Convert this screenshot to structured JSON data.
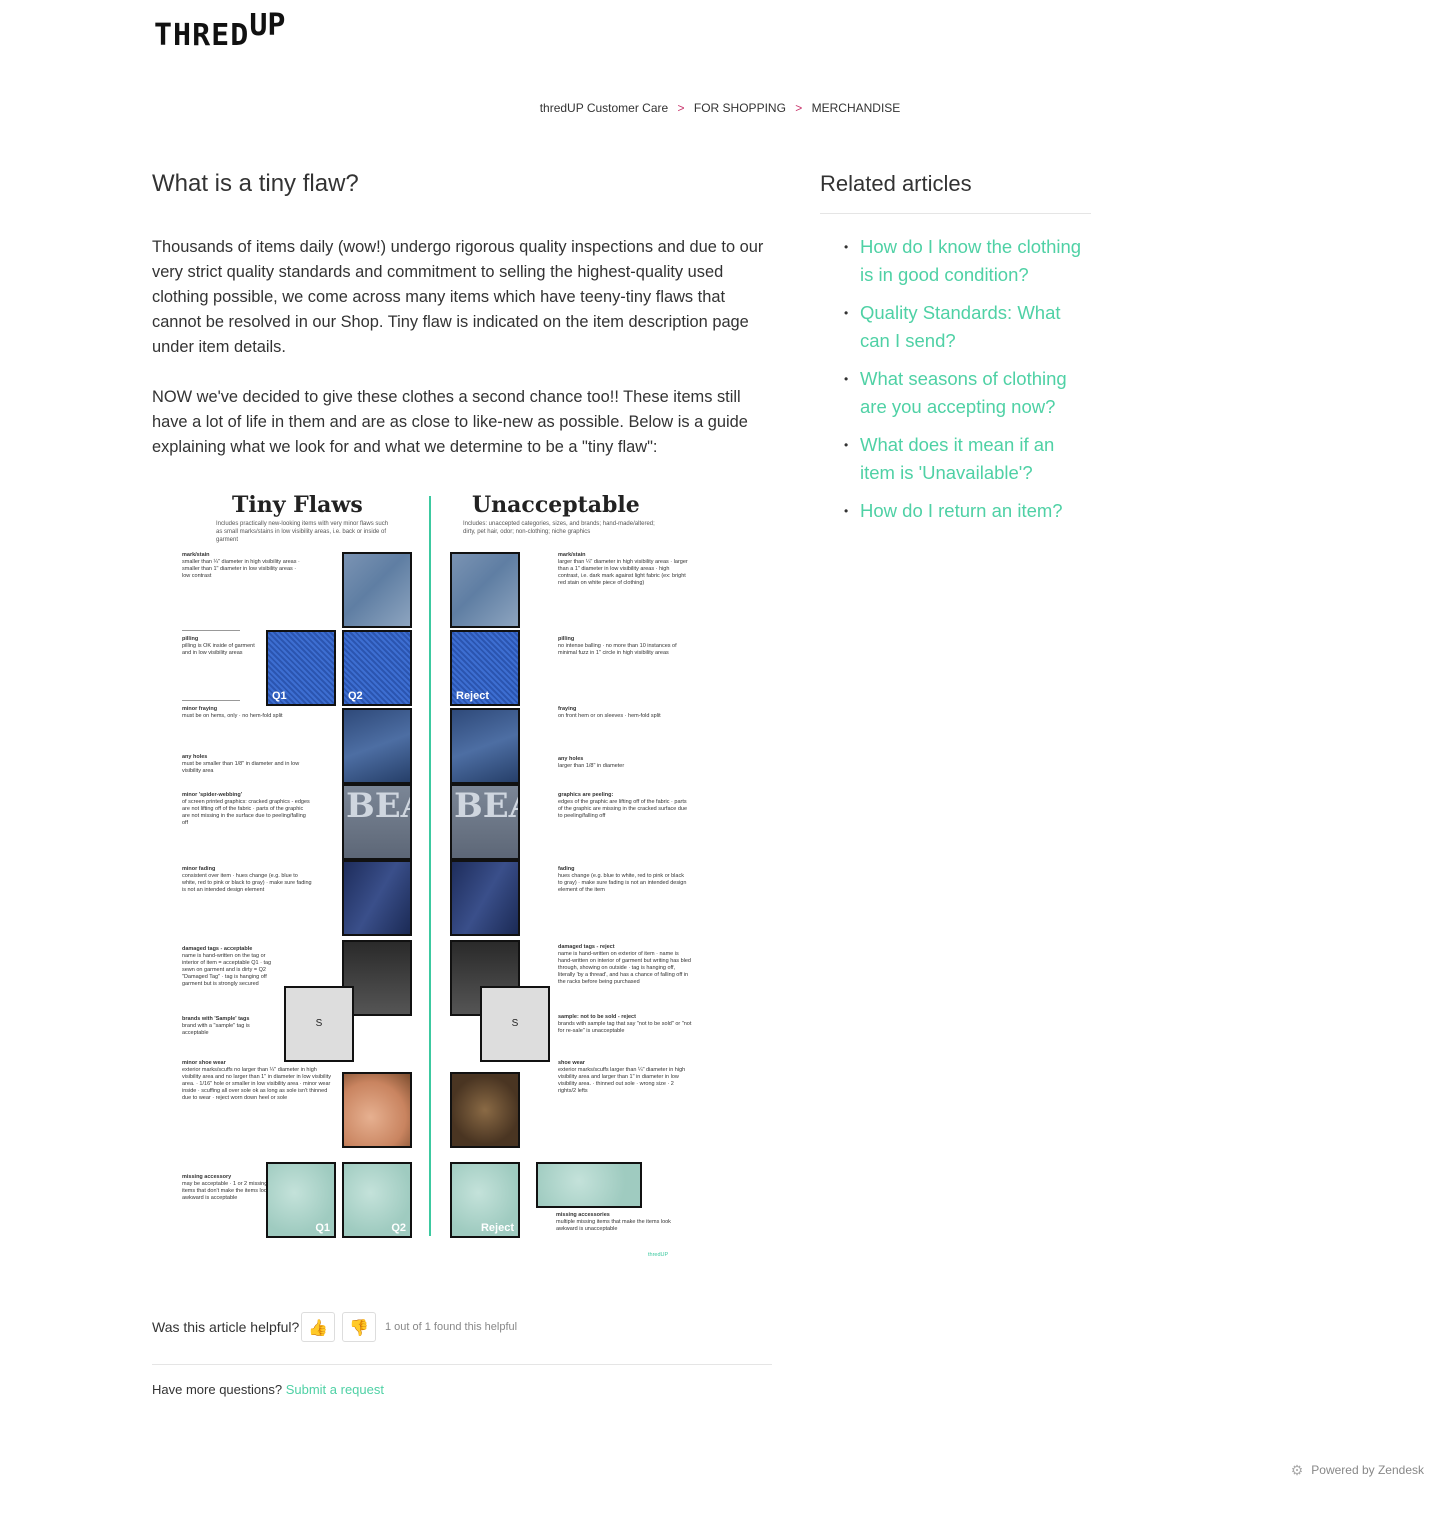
{
  "header": {
    "logo_main": "THRED",
    "logo_sup": "UP"
  },
  "breadcrumbs": [
    {
      "label": "thredUP Customer Care"
    },
    {
      "label": "FOR SHOPPING"
    },
    {
      "label": "MERCHANDISE"
    }
  ],
  "breadcrumb_separator": ">",
  "article": {
    "title": "What is a tiny flaw?",
    "paragraph1": "Thousands of items daily (wow!) undergo rigorous quality inspections and due to our very strict quality standards and commitment to selling the highest-quality used clothing possible, we come across many items which have teeny-tiny flaws that cannot be resolved in our Shop. Tiny flaw is indicated on the item description page under item details.",
    "paragraph2": "NOW we've decided to give these clothes a second chance too!! These items still have a lot of life in them and are as close to like-new as possible. Below is a guide explaining what we look for and what we determine to be a \"tiny flaw\":"
  },
  "guide": {
    "left_title": "Tiny Flaws",
    "left_sub": "Includes practically new-looking items with very minor flaws such as small marks/stains in low visibility areas, i.e. back or inside of garment",
    "right_title": "Unacceptable",
    "right_sub": "Includes: unaccepted categories, sizes, and brands; hand-made/altered; dirty, pet hair, odor; non-clothing; niche graphics",
    "tags": {
      "q1": "Q1",
      "q2": "Q2",
      "reject": "Reject"
    },
    "left_sections": [
      {
        "head": "mark/stain",
        "text": "smaller than ¼\" diameter in high visibility areas · smaller than 1\" diameter in low visibility areas · low contrast"
      },
      {
        "head": "pilling",
        "text": "pilling is OK inside of garment and in low visibility areas"
      },
      {
        "head": "minor fraying",
        "text": "must be on hems, only · no hem-fold split"
      },
      {
        "head": "any holes",
        "text": "must be smaller than 1/8\" in diameter and in low visibility area"
      },
      {
        "head": "minor 'spider-webbing'",
        "text": "of screen printed graphics: cracked graphics - edges are not lifting off of the fabric · parts of the graphic are not missing in the surface due to peeling/falling off"
      },
      {
        "head": "minor fading",
        "text": "consistent over item · hues change (e.g. blue to white, red to pink or black to gray) · make sure fading is not an intended design element"
      },
      {
        "head": "damaged tags - acceptable",
        "text": "name is hand-written on the tag or interior of item = acceptable Q1 · tag sewn on garment and is dirty = Q2 \"Damaged Tag\" · tag is hanging off garment but is strongly secured"
      },
      {
        "head": "brands with 'Sample' tags",
        "text": "brand with a \"sample\" tag is acceptable"
      },
      {
        "head": "minor shoe wear",
        "text": "exterior marks/scuffs no larger than ¼\" diameter in high visibility area and no larger than 1\" in diameter in low visibility area. · 1/16\" hole or smaller in low visibility area · minor wear inside · scuffing all over sole ok as long as sole isn't thinned due to wear · reject worn down heel or sole"
      },
      {
        "head": "missing accessory",
        "text": "may be acceptable · 1 or 2 missing items that don't make the items look awkward is acceptable"
      }
    ],
    "right_sections": [
      {
        "head": "mark/stain",
        "text": "larger than ¼\" diameter in high visibility areas · larger than a 1\" diameter in low visibility areas · high contrast, i.e. dark mark against light fabric (ex: bright red stain on white piece of clothing)"
      },
      {
        "head": "pilling",
        "text": "no intense balling · no more than 10 instances of minimal fuzz in 1\" circle in high visibility areas"
      },
      {
        "head": "fraying",
        "text": "on front hem or on sleeves · hem-fold split"
      },
      {
        "head": "any holes",
        "text": "larger than 1/8\" in diameter"
      },
      {
        "head": "graphics are peeling:",
        "text": "edges of the graphic are lifting off of the fabric · parts of the graphic are missing in the cracked surface due to peeling/falling off"
      },
      {
        "head": "fading",
        "text": "hues change (e.g. blue to white, red to pink or black to gray) · make sure fading is not an intended design element of the item"
      },
      {
        "head": "damaged tags - reject",
        "text": "name is hand-written on exterior of item · name is hand-written on interior of garment but writing has bled through, showing on outside · tag is hanging off, literally 'by a thread', and has a chance of falling off in the racks before being purchased"
      },
      {
        "head": "sample: not to be sold - reject",
        "text": "brands with sample tag that say \"not to be sold\" or \"not for re-sale\" is unacceptable"
      },
      {
        "head": "shoe wear",
        "text": "exterior marks/scuffs larger than ¼\" diameter in high visibility area and larger than 1\" in diameter in low visibility area. · thinned out sole · wrong size · 2 rights/2 lefts"
      },
      {
        "head": "missing accessories",
        "text": "multiple missing items that make the items look awkward is unacceptable"
      }
    ],
    "beat_text": "BEAT",
    "tag_size": "S",
    "footer_logo": "thredUP"
  },
  "feedback": {
    "question": "Was this article helpful?",
    "thumbs_up": "👍",
    "thumbs_down": "👎",
    "count": "1 out of 1 found this helpful"
  },
  "more_questions": {
    "text": "Have more questions?",
    "link": "Submit a request"
  },
  "related": {
    "title": "Related articles",
    "items": [
      {
        "label": "How do I know the clothing is in good condition?"
      },
      {
        "label": "Quality Standards: What can I send?"
      },
      {
        "label": "What seasons of clothing are you accepting now?"
      },
      {
        "label": "What does it mean if an item is 'Unavailable'?"
      },
      {
        "label": "How do I return an item?"
      }
    ]
  },
  "footer": {
    "powered_by": "Powered by Zendesk",
    "icon": "zendesk-gear-icon"
  },
  "colors": {
    "link": "#4fd1a5",
    "breadcrumb_separator": "#c8336b",
    "guide_divider": "#3cc9a0"
  }
}
